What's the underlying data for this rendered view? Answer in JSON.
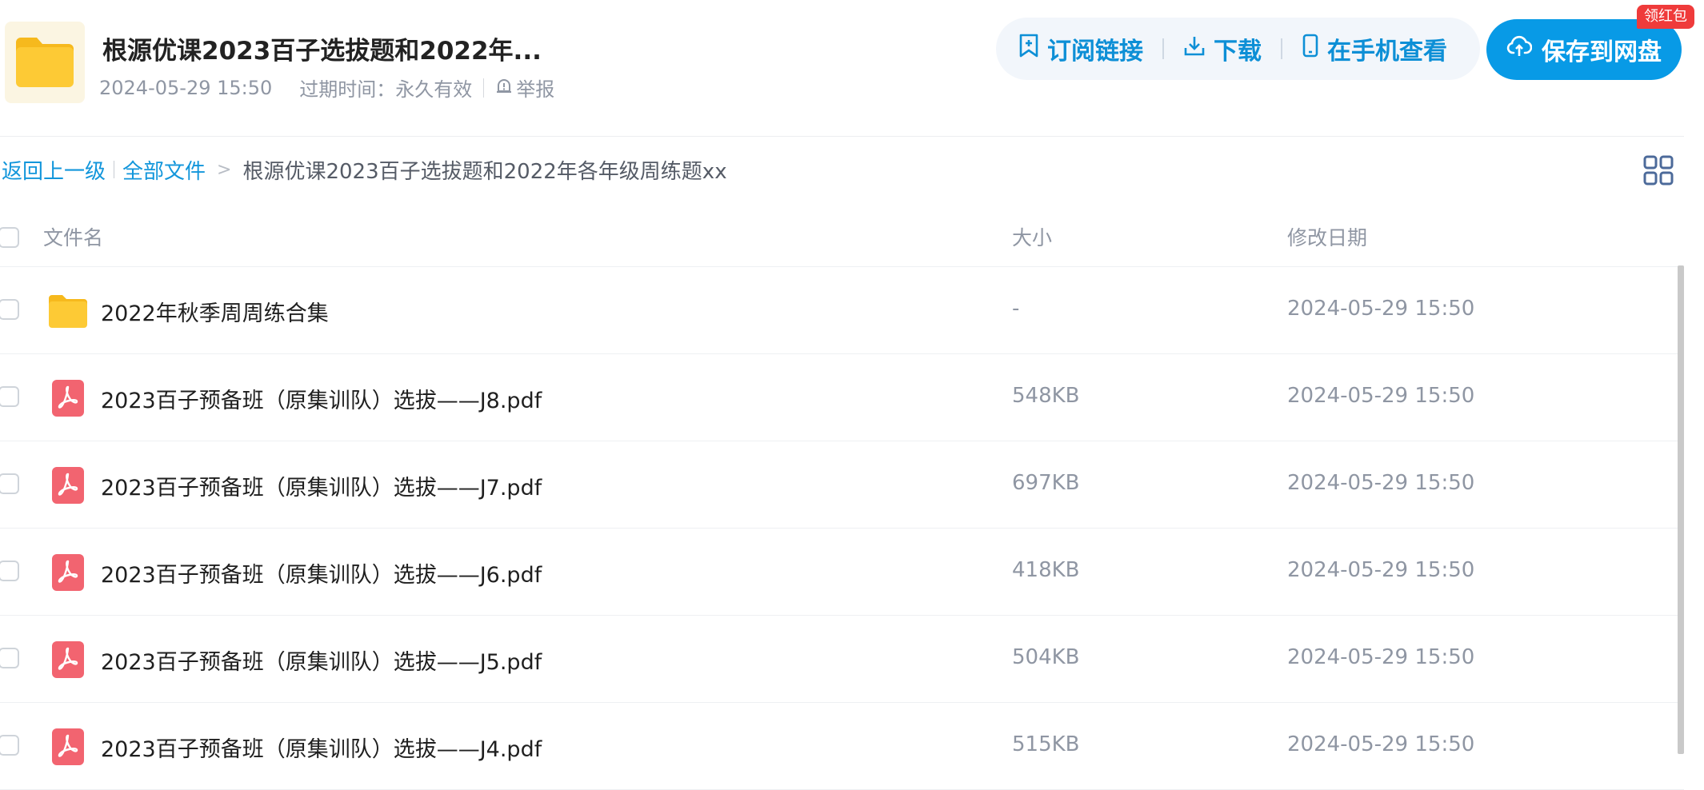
{
  "header": {
    "title": "根源优课2023百子选拔题和2022年...",
    "date": "2024-05-29 15:50",
    "expiry": "过期时间：永久有效",
    "report_label": "举报",
    "actions": {
      "subscribe": "订阅链接",
      "download": "下载",
      "phone_view": "在手机查看"
    },
    "save_button": "保存到网盘",
    "red_packet_badge": "领红包"
  },
  "breadcrumb": {
    "back": "返回上一级",
    "all_files": "全部文件",
    "separator": ">",
    "current": "根源优课2023百子选拔题和2022年各年级周练题xx"
  },
  "table": {
    "columns": {
      "name": "文件名",
      "size": "大小",
      "modified": "修改日期"
    },
    "rows": [
      {
        "type": "folder",
        "name": "2022年秋季周周练合集",
        "size": "-",
        "modified": "2024-05-29 15:50"
      },
      {
        "type": "pdf",
        "name": "2023百子预备班（原集训队）选拔——J8.pdf",
        "size": "548KB",
        "modified": "2024-05-29 15:50"
      },
      {
        "type": "pdf",
        "name": "2023百子预备班（原集训队）选拔——J7.pdf",
        "size": "697KB",
        "modified": "2024-05-29 15:50"
      },
      {
        "type": "pdf",
        "name": "2023百子预备班（原集训队）选拔——J6.pdf",
        "size": "418KB",
        "modified": "2024-05-29 15:50"
      },
      {
        "type": "pdf",
        "name": "2023百子预备班（原集训队）选拔——J5.pdf",
        "size": "504KB",
        "modified": "2024-05-29 15:50"
      },
      {
        "type": "pdf",
        "name": "2023百子预备班（原集训队）选拔——J4.pdf",
        "size": "515KB",
        "modified": "2024-05-29 15:50"
      }
    ]
  },
  "colors": {
    "accent": "#089ae6",
    "link": "#1296db",
    "badge_red": "#ef3b3b",
    "pdf_red": "#f26470",
    "folder_yellow": "#fcc934"
  },
  "icons": {
    "folder": "folder-icon",
    "pdf": "pdf-file-icon",
    "subscribe": "bookmark-add-icon",
    "download": "download-icon",
    "phone": "mobile-phone-icon",
    "save": "cloud-upload-icon",
    "report": "alert-icon",
    "grid": "grid-view-icon"
  }
}
